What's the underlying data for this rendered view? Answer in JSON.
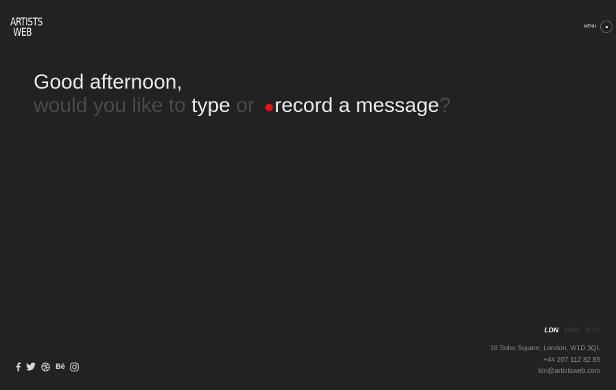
{
  "logo": {
    "line1": "ARTISTS",
    "line2": "WEB"
  },
  "menu": {
    "label": "MENU"
  },
  "greeting": {
    "line1": "Good afternoon,",
    "prefix": "would you like to ",
    "type_label": "type",
    "or_label": " or ",
    "record_label": "record a message",
    "suffix": "?"
  },
  "colors": {
    "background": "#222222",
    "record_dot": "#e4101a",
    "muted_text": "#4a4a4a"
  },
  "offices": [
    {
      "label": "LDN",
      "active": true
    },
    {
      "label": "PRG",
      "active": false
    },
    {
      "label": "NYC",
      "active": false
    }
  ],
  "contact": {
    "address": "18 Soho Square, London, W1D 3QL",
    "phone": "+44 207 112 82 85",
    "email": "ldn@artistsweb.com"
  },
  "social": [
    {
      "name": "facebook-icon"
    },
    {
      "name": "twitter-icon"
    },
    {
      "name": "dribbble-icon"
    },
    {
      "name": "behance-icon",
      "text": "Bē"
    },
    {
      "name": "instagram-icon"
    }
  ]
}
